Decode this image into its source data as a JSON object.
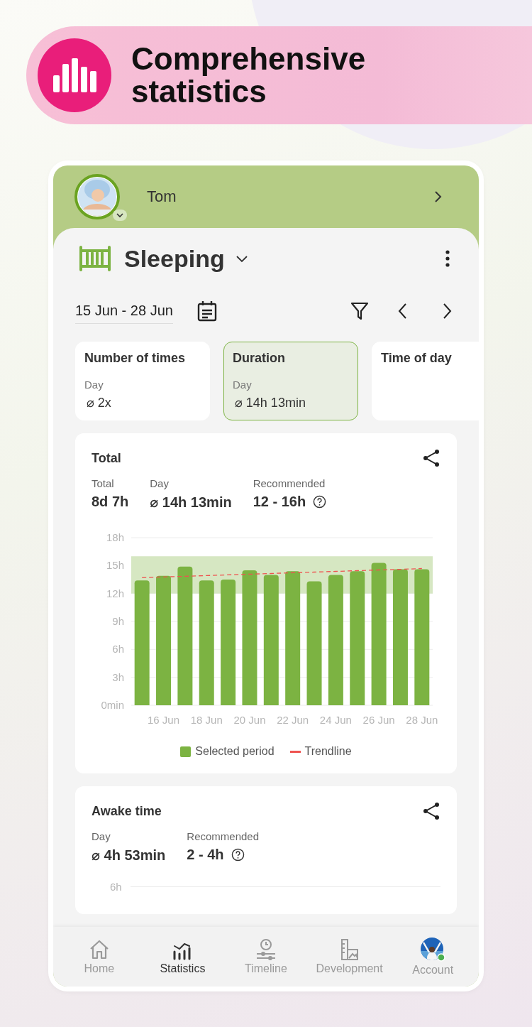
{
  "banner": {
    "title": "Comprehensive statistics"
  },
  "child": {
    "name": "Tom"
  },
  "category": {
    "title": "Sleeping"
  },
  "date_range": "15 Jun - 28 Jun",
  "metric_tabs": [
    {
      "title": "Number of times",
      "period": "Day",
      "value": "⌀ 2x",
      "selected": false
    },
    {
      "title": "Duration",
      "period": "Day",
      "value": "⌀ 14h 13min",
      "selected": true
    },
    {
      "title": "Time of day",
      "selected": false
    }
  ],
  "total_card": {
    "title": "Total",
    "stats": [
      {
        "label": "Total",
        "value": "8d 7h",
        "kind": "plain"
      },
      {
        "label": "Day",
        "value": "⌀ 14h 13min",
        "kind": "plain"
      },
      {
        "label": "Recommended",
        "value": "12 - 16h",
        "kind": "help"
      }
    ],
    "chart_data": {
      "type": "bar",
      "categories": [
        null,
        "16 Jun",
        null,
        "18 Jun",
        null,
        "20 Jun",
        null,
        "22 Jun",
        null,
        "24 Jun",
        null,
        "26 Jun",
        null,
        "28 Jun"
      ],
      "series": [
        {
          "name": "Selected period",
          "color": "#7cb342",
          "values": [
            13.4,
            13.9,
            14.9,
            13.4,
            13.5,
            14.5,
            14.0,
            14.4,
            13.3,
            14.0,
            14.4,
            15.3,
            14.6,
            14.6
          ]
        },
        {
          "name": "Trendline",
          "type": "line",
          "line_style": "dashed",
          "color": "#ef5350",
          "values": [
            13.7,
            13.78,
            13.85,
            13.93,
            14.0,
            14.08,
            14.15,
            14.23,
            14.3,
            14.38,
            14.45,
            14.53,
            14.6,
            14.68
          ]
        }
      ],
      "ylim": [
        0,
        18
      ],
      "yticks": [
        {
          "value": 0,
          "label": "0min"
        },
        {
          "value": 3,
          "label": "3h"
        },
        {
          "value": 6,
          "label": "6h"
        },
        {
          "value": 9,
          "label": "9h"
        },
        {
          "value": 12,
          "label": "12h"
        },
        {
          "value": 15,
          "label": "15h"
        },
        {
          "value": 18,
          "label": "18h"
        }
      ],
      "grid": true,
      "bands": [
        {
          "axis": "y",
          "from": 12,
          "to": 16
        }
      ]
    }
  },
  "awake_card": {
    "title": "Awake time",
    "stats": [
      {
        "label": "Day",
        "value": "⌀ 4h 53min",
        "kind": "plain"
      },
      {
        "label": "Recommended",
        "value": "2 - 4h",
        "kind": "help"
      }
    ],
    "axis_label": "6h"
  },
  "bottom_nav": [
    {
      "label": "Home",
      "selected": false
    },
    {
      "label": "Statistics",
      "selected": true
    },
    {
      "label": "Timeline",
      "selected": false
    },
    {
      "label": "Development",
      "selected": false
    },
    {
      "label": "Account",
      "selected": false
    }
  ]
}
